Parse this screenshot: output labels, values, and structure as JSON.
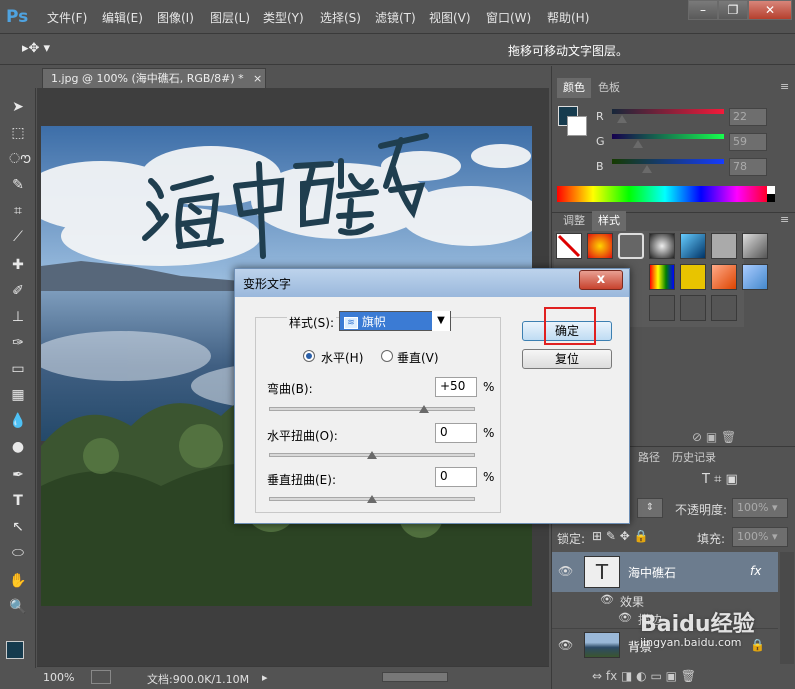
{
  "app": {
    "logo": "Ps"
  },
  "menu": [
    "文件(F)",
    "编辑(E)",
    "图像(I)",
    "图层(L)",
    "类型(Y)",
    "选择(S)",
    "滤镜(T)",
    "视图(V)",
    "窗口(W)",
    "帮助(H)"
  ],
  "window_controls": {
    "minimize": "–",
    "restore": "❐",
    "close": "✕"
  },
  "options": {
    "hint": "拖移可移动文字图层。"
  },
  "document": {
    "tab_title": "1.jpg @ 100% (海中礁石, RGB/8#) *",
    "close": "×",
    "text_layer": "海中礁石"
  },
  "status": {
    "zoom": "100%",
    "doc_info": "文档:900.0K/1.10M"
  },
  "color_panel": {
    "tabs": [
      "颜色",
      "色板"
    ],
    "channels": [
      {
        "label": "R",
        "value": "22",
        "position": 0.09
      },
      {
        "label": "G",
        "value": "59",
        "position": 0.23
      },
      {
        "label": "B",
        "value": "78",
        "position": 0.31
      }
    ],
    "foreground": "#163b4e"
  },
  "styles_panel": {
    "tabs": [
      "调整",
      "样式"
    ]
  },
  "layers_panel": {
    "tabs": [
      "路径",
      "历史记录"
    ],
    "opacity_label": "不透明度:",
    "opacity_value": "100%",
    "lock_label": "锁定:",
    "fill_label": "填充:",
    "fill_value": "100%",
    "layers": [
      {
        "name": "海中礁石",
        "thumb": "T",
        "fx": "fx"
      },
      {
        "name": "效果"
      },
      {
        "name": "描边"
      },
      {
        "name": "背景"
      }
    ]
  },
  "dialog": {
    "title": "变形文字",
    "style_label": "样式(S):",
    "style_value": "旗帜",
    "style_icon": "flag-icon",
    "horizontal_label": "水平(H)",
    "vertical_label": "垂直(V)",
    "bend_label": "弯曲(B):",
    "bend_value": "+50",
    "bend_level": 0.75,
    "hdist_label": "水平扭曲(O):",
    "hdist_value": "0",
    "hdist_level": 0.5,
    "vdist_label": "垂直扭曲(E):",
    "vdist_value": "0",
    "vdist_level": 0.5,
    "percent": "%",
    "ok": "确定",
    "reset": "复位",
    "close": "x"
  },
  "watermark": {
    "text": "Baidu经验",
    "url": "jingyan.baidu.com"
  }
}
